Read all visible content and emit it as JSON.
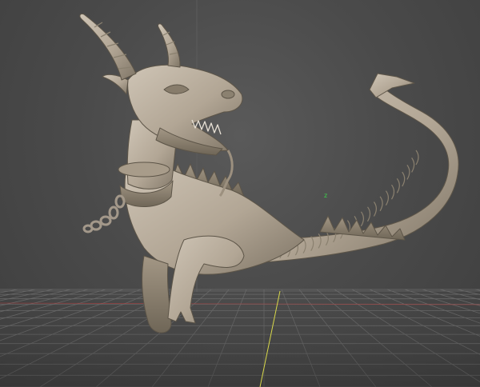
{
  "viewport": {
    "mode": "perspective",
    "axis_indicator": "z"
  },
  "scene": {
    "model": "dragon-sculpt",
    "grid": true
  },
  "colors": {
    "background": "#4a4a4a",
    "grid_line": "#6a6a6a",
    "axis_x": "#c43a3a",
    "axis_y": "#d8d84a",
    "axis_z": "#3cd04a",
    "clay": "#b6ab9b"
  }
}
